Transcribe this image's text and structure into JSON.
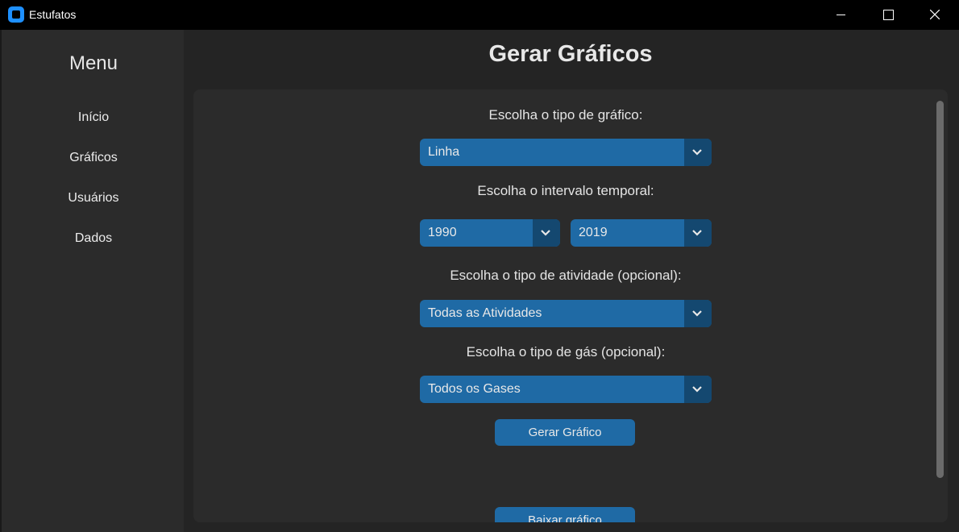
{
  "window": {
    "title": "Estufatos",
    "icon": "app-icon"
  },
  "sidebar": {
    "title": "Menu",
    "items": [
      {
        "label": "Início"
      },
      {
        "label": "Gráficos"
      },
      {
        "label": "Usuários"
      },
      {
        "label": "Dados"
      }
    ]
  },
  "main": {
    "title": "Gerar Gráficos",
    "chart_type": {
      "label": "Escolha o tipo de gráfico:",
      "value": "Linha"
    },
    "interval": {
      "label": "Escolha o intervalo temporal:",
      "start": "1990",
      "end": "2019"
    },
    "activity": {
      "label": "Escolha o tipo de atividade (opcional):",
      "value": "Todas as Atividades"
    },
    "gas": {
      "label": "Escolha o tipo de gás (opcional):",
      "value": "Todos os Gases"
    },
    "generate_button": "Gerar Gráfico",
    "second_button": "Baixar gráfico"
  },
  "colors": {
    "accent": "#1f6aa5",
    "accent_dark": "#144870",
    "panel": "#2b2b2b",
    "background": "#242424",
    "titlebar": "#000000"
  }
}
